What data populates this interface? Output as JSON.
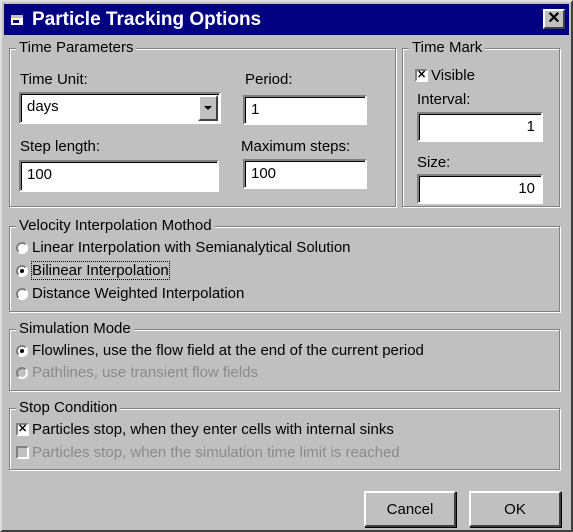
{
  "window": {
    "title": "Particle Tracking Options",
    "close_glyph": "✕"
  },
  "time_parameters": {
    "legend": "Time Parameters",
    "time_unit_label": "Time Unit:",
    "time_unit_value": "days",
    "period_label": "Period:",
    "period_value": "1",
    "step_length_label": "Step length:",
    "step_length_value": "100",
    "max_steps_label": "Maximum steps:",
    "max_steps_value": "100"
  },
  "time_mark": {
    "legend": "Time Mark",
    "visible_label": "Visible",
    "visible_checked": true,
    "interval_label": "Interval:",
    "interval_value": "1",
    "size_label": "Size:",
    "size_value": "10"
  },
  "velocity": {
    "legend": "Velocity Interpolation Mothod",
    "options": [
      {
        "label": "Linear Interpolation with Semianalytical Solution",
        "selected": false
      },
      {
        "label": "Bilinear Interpolation",
        "selected": true
      },
      {
        "label": "Distance Weighted Interpolation",
        "selected": false
      }
    ]
  },
  "simulation": {
    "legend": "Simulation Mode",
    "options": [
      {
        "label": "Flowlines, use the flow field at the end of the current period",
        "selected": true,
        "enabled": true
      },
      {
        "label": "Pathlines, use transient flow fields",
        "selected": false,
        "enabled": false
      }
    ]
  },
  "stop": {
    "legend": "Stop Condition",
    "options": [
      {
        "label": "Particles stop, when they enter cells with internal sinks",
        "checked": true,
        "enabled": true
      },
      {
        "label": "Particles stop, when the simulation time limit is reached",
        "checked": false,
        "enabled": false
      }
    ]
  },
  "buttons": {
    "cancel": "Cancel",
    "ok": "OK"
  },
  "colors": {
    "titlebar": "#000080",
    "face": "#c0c0c0",
    "disabled_text": "#8a8a8a"
  }
}
